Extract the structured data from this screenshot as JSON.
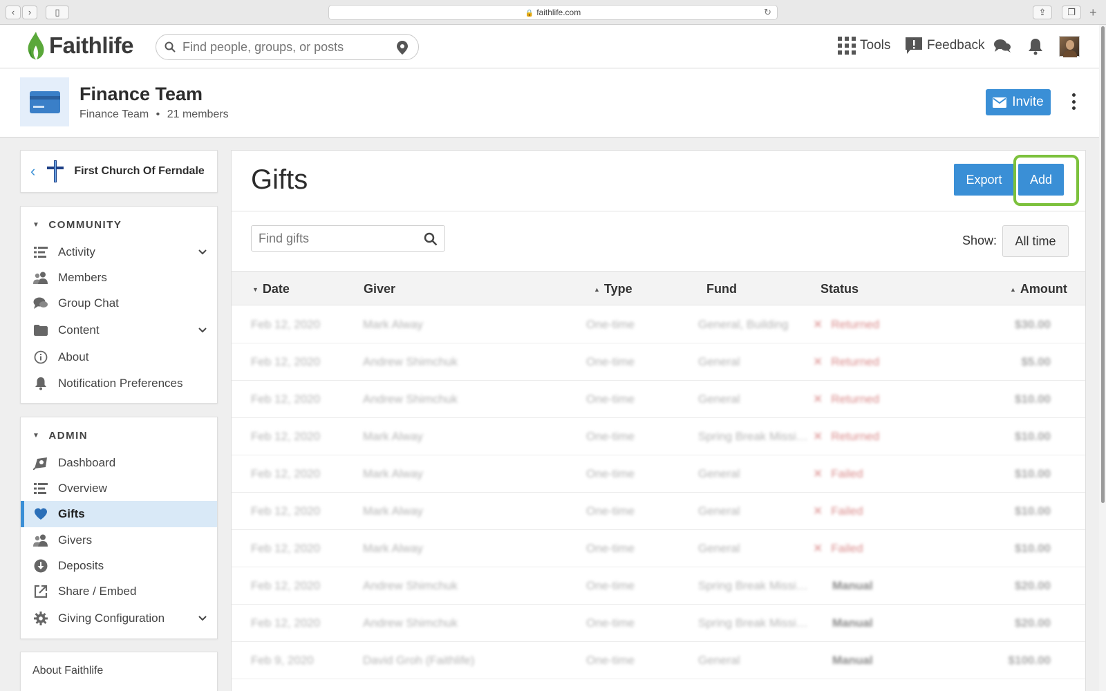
{
  "browser": {
    "url": "faithlife.com"
  },
  "topnav": {
    "logo": "Faithlife",
    "search_placeholder": "Find people, groups, or posts",
    "tools": "Tools",
    "feedback": "Feedback"
  },
  "group": {
    "title": "Finance Team",
    "subtitle": "Finance Team",
    "members": "21 members",
    "invite": "Invite"
  },
  "sidebar": {
    "church": "First Church Of Ferndale",
    "community_head": "COMMUNITY",
    "community": [
      {
        "label": "Activity",
        "icon": "list-icon",
        "chevron": true
      },
      {
        "label": "Members",
        "icon": "people-icon",
        "chevron": false
      },
      {
        "label": "Group Chat",
        "icon": "chat-icon",
        "chevron": false
      },
      {
        "label": "Content",
        "icon": "folder-icon",
        "chevron": true
      },
      {
        "label": "About",
        "icon": "info-icon",
        "chevron": false
      },
      {
        "label": "Notification Preferences",
        "icon": "bell-icon",
        "chevron": false
      }
    ],
    "admin_head": "ADMIN",
    "admin": [
      {
        "label": "Dashboard",
        "icon": "dashboard-icon",
        "chevron": false
      },
      {
        "label": "Overview",
        "icon": "list-icon",
        "chevron": false
      },
      {
        "label": "Gifts",
        "icon": "heart-icon",
        "chevron": false,
        "active": true
      },
      {
        "label": "Givers",
        "icon": "people-icon",
        "chevron": false
      },
      {
        "label": "Deposits",
        "icon": "download-icon",
        "chevron": false
      },
      {
        "label": "Share / Embed",
        "icon": "share-icon",
        "chevron": false
      },
      {
        "label": "Giving Configuration",
        "icon": "gear-icon",
        "chevron": true
      }
    ],
    "about_faithlife": "About Faithlife"
  },
  "main": {
    "title": "Gifts",
    "export": "Export",
    "add": "Add",
    "find_placeholder": "Find gifts",
    "show_label": "Show:",
    "show_value": "All time",
    "columns": {
      "date": "Date",
      "giver": "Giver",
      "type": "Type",
      "fund": "Fund",
      "status": "Status",
      "amount": "Amount"
    },
    "rows": [
      {
        "date": "Feb 12, 2020",
        "giver": "Mark Alway",
        "type": "One-time",
        "fund": "General, Building",
        "status": "Returned",
        "amount": "$30.00"
      },
      {
        "date": "Feb 12, 2020",
        "giver": "Andrew Shimchuk",
        "type": "One-time",
        "fund": "General",
        "status": "Returned",
        "amount": "$5.00"
      },
      {
        "date": "Feb 12, 2020",
        "giver": "Andrew Shimchuk",
        "type": "One-time",
        "fund": "General",
        "status": "Returned",
        "amount": "$10.00"
      },
      {
        "date": "Feb 12, 2020",
        "giver": "Mark Alway",
        "type": "One-time",
        "fund": "Spring Break Missi…",
        "status": "Returned",
        "amount": "$10.00"
      },
      {
        "date": "Feb 12, 2020",
        "giver": "Mark Alway",
        "type": "One-time",
        "fund": "General",
        "status": "Failed",
        "amount": "$10.00"
      },
      {
        "date": "Feb 12, 2020",
        "giver": "Mark Alway",
        "type": "One-time",
        "fund": "General",
        "status": "Failed",
        "amount": "$10.00"
      },
      {
        "date": "Feb 12, 2020",
        "giver": "Mark Alway",
        "type": "One-time",
        "fund": "General",
        "status": "Failed",
        "amount": "$10.00"
      },
      {
        "date": "Feb 12, 2020",
        "giver": "Andrew Shimchuk",
        "type": "One-time",
        "fund": "Spring Break Missi…",
        "status": "Manual",
        "amount": "$20.00"
      },
      {
        "date": "Feb 12, 2020",
        "giver": "Andrew Shimchuk",
        "type": "One-time",
        "fund": "Spring Break Missi…",
        "status": "Manual",
        "amount": "$20.00"
      },
      {
        "date": "Feb 9, 2020",
        "giver": "David Groh (Faithlife)",
        "type": "One-time",
        "fund": "General",
        "status": "Manual",
        "amount": "$100.00"
      }
    ]
  },
  "colors": {
    "accent": "#3a8fd6",
    "highlight": "#7cc13c",
    "brand_green": "#5aa83a",
    "error": "#d98a8a"
  }
}
